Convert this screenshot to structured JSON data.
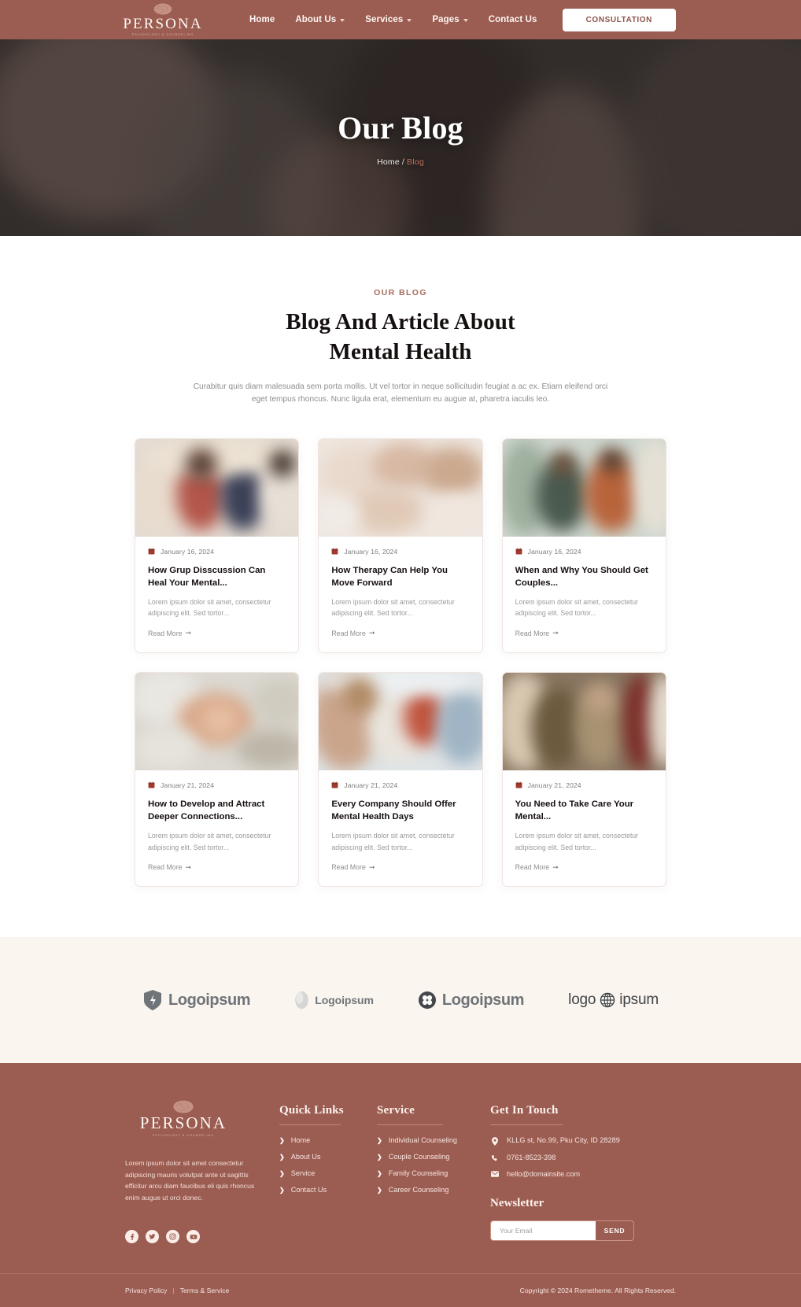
{
  "header": {
    "logo": {
      "word": "PERSONA",
      "sub": "PSYCHOLOGY & COUNSELING",
      "icon": "brain-icon"
    },
    "nav": [
      {
        "label": "Home",
        "has_dropdown": false
      },
      {
        "label": "About Us",
        "has_dropdown": true
      },
      {
        "label": "Services",
        "has_dropdown": true
      },
      {
        "label": "Pages",
        "has_dropdown": true
      },
      {
        "label": "Contact Us",
        "has_dropdown": false
      }
    ],
    "cta": "CONSULTATION"
  },
  "hero": {
    "title": "Our Blog",
    "breadcrumb_home": "Home",
    "breadcrumb_sep": "/",
    "breadcrumb_current": "Blog"
  },
  "blog": {
    "eyebrow": "OUR BLOG",
    "title_line1": "Blog And Article About",
    "title_line2": "Mental Health",
    "description": "Curabitur quis diam malesuada sem porta mollis. Ut vel tortor in neque sollicitudin feugiat a ac ex. Etiam eleifend orci eget tempus rhoncus. Nunc ligula erat, elementum eu augue at, pharetra iaculis leo.",
    "read_more_label": "Read More",
    "posts": [
      {
        "date": "January 16, 2024",
        "title": "How Grup Disscussion Can Heal Your Mental...",
        "excerpt": "Lorem ipsum dolor sit amet, consectetur adipiscing elit. Sed tortor..."
      },
      {
        "date": "January 16, 2024",
        "title": "How Therapy Can Help You Move Forward",
        "excerpt": "Lorem ipsum dolor sit amet, consectetur adipiscing elit. Sed tortor..."
      },
      {
        "date": "January 16, 2024",
        "title": "When and Why You Should Get Couples...",
        "excerpt": "Lorem ipsum dolor sit amet, consectetur adipiscing elit. Sed tortor..."
      },
      {
        "date": "January 21, 2024",
        "title": "How to Develop and Attract Deeper Connections...",
        "excerpt": "Lorem ipsum dolor sit amet, consectetur adipiscing elit. Sed tortor..."
      },
      {
        "date": "January 21, 2024",
        "title": "Every Company Should Offer Mental Health Days",
        "excerpt": "Lorem ipsum dolor sit amet, consectetur adipiscing elit. Sed tortor..."
      },
      {
        "date": "January 21, 2024",
        "title": "You Need to Take Care Your Mental...",
        "excerpt": "Lorem ipsum dolor sit amet, consectetur adipiscing elit. Sed tortor..."
      }
    ]
  },
  "partners": [
    {
      "name": "Logoipsum",
      "icon": "shield-logo-icon"
    },
    {
      "name": "Logoipsum",
      "icon": "sphere-logo-icon"
    },
    {
      "name": "Logoipsum",
      "icon": "clover-logo-icon"
    },
    {
      "name_left": "logo",
      "name_right": "ipsum",
      "icon": "globe-logo-icon"
    }
  ],
  "footer": {
    "logo": {
      "word": "PERSONA",
      "sub": "PSYCHOLOGY & COUNSELING",
      "icon": "brain-icon"
    },
    "description": "Lorem ipsum dolor sit amet consectetur adipiscing mauris volutpat ante ut sagittis efficitur arcu diam faucibus eli quis rhoncus enim augue ut orci donec.",
    "socials": [
      "facebook-icon",
      "twitter-icon",
      "instagram-icon",
      "youtube-icon"
    ],
    "quick_links": {
      "heading": "Quick Links",
      "items": [
        "Home",
        "About Us",
        "Service",
        "Contact Us"
      ]
    },
    "service": {
      "heading": "Service",
      "items": [
        "Individual Counseling",
        "Couple Counseling",
        "Family Counseling",
        "Career Counseling"
      ]
    },
    "touch": {
      "heading": "Get In Touch",
      "address": "KLLG st, No.99, Pku City, ID 28289",
      "phone": "0761-8523-398",
      "email": "hello@domainsite.com"
    },
    "newsletter": {
      "heading": "Newsletter",
      "placeholder": "Your Email",
      "value": "",
      "button": "SEND"
    },
    "bottom": {
      "privacy": "Privacy Policy",
      "divider": "|",
      "terms": "Terms & Service",
      "copyright": "Copyright © 2024 Rometheme. All Rights Reserved."
    }
  },
  "colors": {
    "brand": "#9b5c51",
    "cream": "#faf5ee",
    "accent_text": "#a96a5d"
  }
}
